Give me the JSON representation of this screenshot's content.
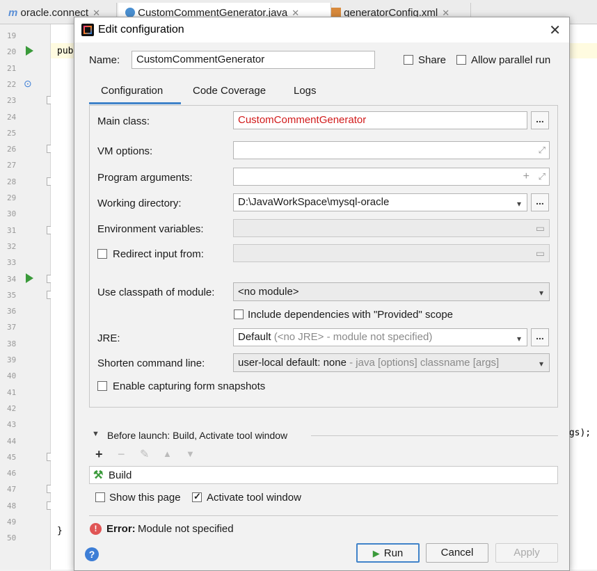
{
  "editor_tabs": [
    {
      "label": "oracle.connect",
      "icon": "m-icon"
    },
    {
      "label": "CustomCommentGenerator.java",
      "icon": "class-icon"
    },
    {
      "label": "generatorConfig.xml",
      "icon": "xml-icon"
    }
  ],
  "gutter_lines": [
    "19",
    "20",
    "21",
    "22",
    "23",
    "24",
    "25",
    "26",
    "27",
    "28",
    "29",
    "30",
    "31",
    "32",
    "33",
    "34",
    "35",
    "36",
    "37",
    "38",
    "39",
    "40",
    "41",
    "42",
    "43",
    "44",
    "45",
    "46",
    "47",
    "48",
    "49",
    "50"
  ],
  "code_fragments": {
    "line20": "pub",
    "line43": "ngs);",
    "line49": "}"
  },
  "dialog": {
    "title": "Edit configuration",
    "name_label": "Name:",
    "name_value": "CustomCommentGenerator",
    "share_label": "Share",
    "allow_parallel_label": "Allow parallel run",
    "tabs": [
      "Configuration",
      "Code Coverage",
      "Logs"
    ],
    "config": {
      "main_class_label": "Main class:",
      "main_class_value": "CustomCommentGenerator",
      "vm_options_label": "VM options:",
      "program_args_label": "Program arguments:",
      "working_dir_label": "Working directory:",
      "working_dir_value": "D:\\JavaWorkSpace\\mysql-oracle",
      "env_vars_label": "Environment variables:",
      "redirect_input_label": "Redirect input from:",
      "classpath_label": "Use classpath of module:",
      "classpath_value": "<no module>",
      "include_deps_label": "Include dependencies with \"Provided\" scope",
      "jre_label": "JRE:",
      "jre_value": "Default",
      "jre_hint": "(<no JRE> - module not specified)",
      "shorten_label": "Shorten command line:",
      "shorten_value": "user-local default: none",
      "shorten_hint": "- java [options] classname [args]",
      "enable_snapshots_label": "Enable capturing form snapshots"
    },
    "before_launch_label": "Before launch: Build, Activate tool window",
    "build_item": "Build",
    "show_page_label": "Show this page",
    "activate_tool_label": "Activate tool window",
    "error_prefix": "Error:",
    "error_message": "Module not specified",
    "buttons": {
      "run": "Run",
      "cancel": "Cancel",
      "apply": "Apply"
    },
    "dots": "...",
    "colors": {
      "error_text": "#d11a1a",
      "accent": "#4083c9",
      "run_green": "#3a9a3a"
    }
  }
}
